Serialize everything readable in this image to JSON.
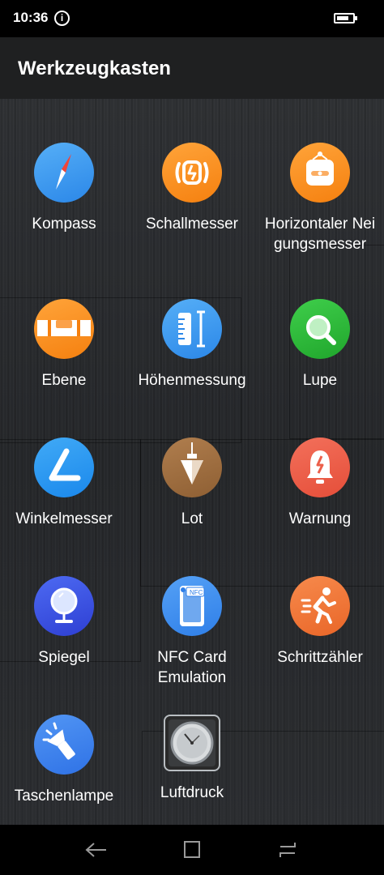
{
  "status_bar": {
    "time": "10:36",
    "info_icon": "info-icon",
    "battery_icon": "battery-icon"
  },
  "app_bar": {
    "title": "Werkzeugkasten"
  },
  "tools": [
    {
      "lines": [
        "Kompass"
      ],
      "icon": "compass-icon",
      "color": "#3b96f0"
    },
    {
      "lines": [
        "Schallmesser"
      ],
      "icon": "sound-meter-icon",
      "color": "#fb8f1e"
    },
    {
      "lines": [
        "Horizontaler Nei",
        "gungsmesser"
      ],
      "icon": "tilt-meter-icon",
      "color": "#fb8f1e"
    },
    {
      "lines": [
        "Ebene"
      ],
      "icon": "level-icon",
      "color": "#fb8f1e"
    },
    {
      "lines": [
        "Höhenmessung"
      ],
      "icon": "height-measure-icon",
      "color": "#3b96f0"
    },
    {
      "lines": [
        "Lupe"
      ],
      "icon": "magnifier-icon",
      "color": "#2fba3b"
    },
    {
      "lines": [
        "Winkelmesser"
      ],
      "icon": "protractor-icon",
      "color": "#2597f2"
    },
    {
      "lines": [
        "Lot"
      ],
      "icon": "plumb-bob-icon",
      "color": "#a0703f"
    },
    {
      "lines": [
        "Warnung"
      ],
      "icon": "alarm-bell-icon",
      "color": "#ec5f4a"
    },
    {
      "lines": [
        "Spiegel"
      ],
      "icon": "mirror-icon",
      "color": "#3952e6"
    },
    {
      "lines": [
        "NFC Card",
        "Emulation"
      ],
      "icon": "nfc-card-icon",
      "color": "#3f8ff0"
    },
    {
      "lines": [
        "Schrittzähler"
      ],
      "icon": "pedometer-icon",
      "color": "#f07a3a"
    },
    {
      "lines": [
        "Taschenlampe"
      ],
      "icon": "flashlight-icon",
      "color": "#3f82ee"
    },
    {
      "lines": [
        "Luftdruck"
      ],
      "icon": "barometer-icon",
      "color": "#cfd3d6"
    }
  ],
  "nav_bar": {
    "back": "back-arrow-icon",
    "home": "home-square-icon",
    "recents": "recents-icon"
  }
}
